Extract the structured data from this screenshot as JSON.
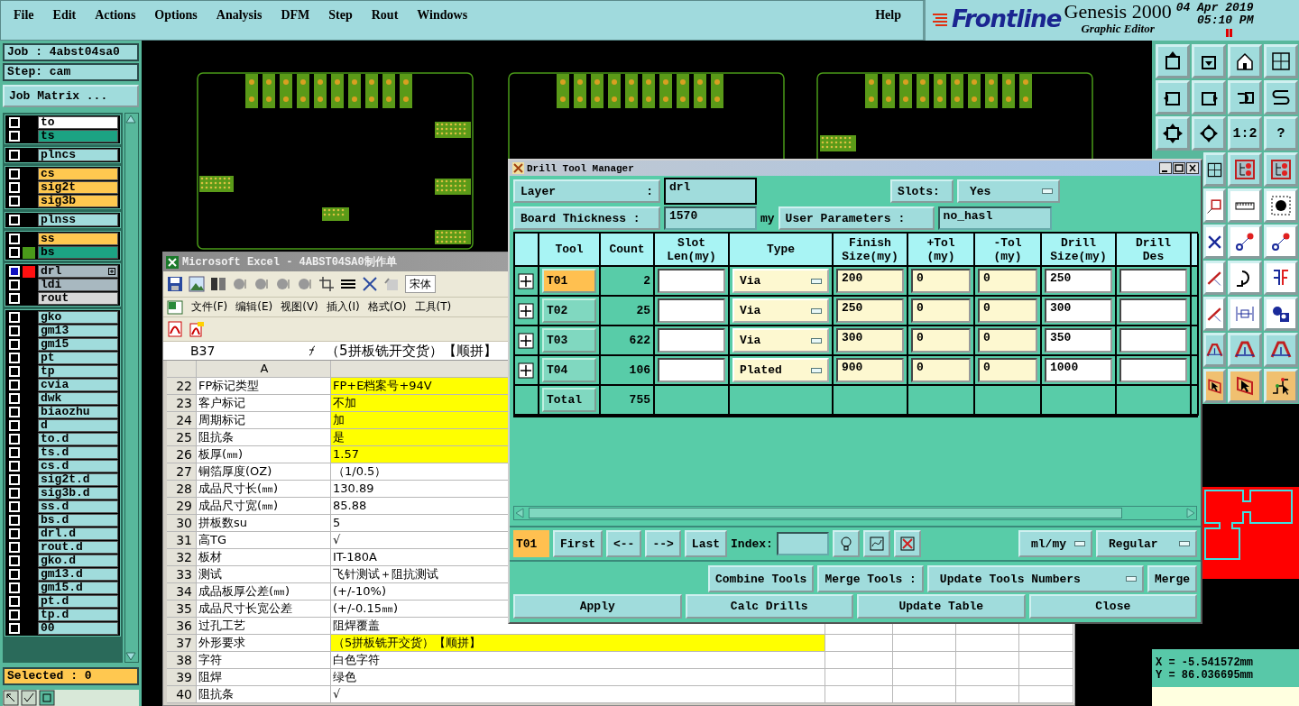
{
  "menu": {
    "items": [
      "File",
      "Edit",
      "Actions",
      "Options",
      "Analysis",
      "DFM",
      "Step",
      "Rout",
      "Windows"
    ],
    "help": "Help"
  },
  "logo": {
    "brand": "Frontline",
    "product": "Genesis 2000",
    "subtitle": "Graphic Editor",
    "date": "04 Apr 2019",
    "time": "05:10 PM"
  },
  "job_panel": {
    "job": "Job : 4abst04sa0",
    "step": "Step: cam",
    "matrix_button": "Job Matrix ..."
  },
  "layer_groups": [
    {
      "layers": [
        {
          "name": "to",
          "color": "#ffffff",
          "selected": false
        },
        {
          "name": "ts",
          "color": "#1ca383",
          "selected": false
        }
      ]
    },
    {
      "layers": [
        {
          "name": "plncs",
          "color": "#a0dcdc",
          "selected": false
        }
      ]
    },
    {
      "layers": [
        {
          "name": "cs",
          "color": "#ffc850",
          "selected": false
        },
        {
          "name": "sig2t",
          "color": "#ffc850",
          "selected": false
        },
        {
          "name": "sig3b",
          "color": "#ffc850",
          "selected": false
        }
      ]
    },
    {
      "layers": [
        {
          "name": "plnss",
          "color": "#a0dcdc",
          "selected": false
        }
      ]
    },
    {
      "layers": [
        {
          "name": "ss",
          "color": "#ffc850",
          "selected": false
        },
        {
          "name": "bs",
          "color": "#1ca383",
          "selected": false,
          "swatch": {
            "color": "#4a9a1a"
          }
        }
      ]
    },
    {
      "layers": [
        {
          "name": "drl",
          "color": "#a8b8c0",
          "selected": true,
          "swatch": {
            "color": "#ff1010"
          }
        },
        {
          "name": "ldi",
          "color": "#a8b8c0",
          "selected": false
        },
        {
          "name": "rout",
          "color": "#d8d8d8",
          "selected": false
        }
      ]
    },
    {
      "layers": [
        {
          "name": "gko",
          "color": "#a0dcdc",
          "selected": false
        },
        {
          "name": "gm13",
          "color": "#a0dcdc",
          "selected": false
        },
        {
          "name": "gm15",
          "color": "#a0dcdc",
          "selected": false
        },
        {
          "name": "pt",
          "color": "#a0dcdc",
          "selected": false
        },
        {
          "name": "tp",
          "color": "#a0dcdc",
          "selected": false
        },
        {
          "name": "cvia",
          "color": "#a0dcdc",
          "selected": false
        },
        {
          "name": "dwk",
          "color": "#a0dcdc",
          "selected": false
        },
        {
          "name": "biaozhu",
          "color": "#a0dcdc",
          "selected": false
        },
        {
          "name": "d",
          "color": "#a0dcdc",
          "selected": false
        },
        {
          "name": "to.d",
          "color": "#a0dcdc",
          "selected": false
        },
        {
          "name": "ts.d",
          "color": "#a0dcdc",
          "selected": false
        },
        {
          "name": "cs.d",
          "color": "#a0dcdc",
          "selected": false
        },
        {
          "name": "sig2t.d",
          "color": "#a0dcdc",
          "selected": false
        },
        {
          "name": "sig3b.d",
          "color": "#a0dcdc",
          "selected": false
        },
        {
          "name": "ss.d",
          "color": "#a0dcdc",
          "selected": false
        },
        {
          "name": "bs.d",
          "color": "#a0dcdc",
          "selected": false
        },
        {
          "name": "drl.d",
          "color": "#a0dcdc",
          "selected": false
        },
        {
          "name": "rout.d",
          "color": "#a0dcdc",
          "selected": false
        },
        {
          "name": "gko.d",
          "color": "#a0dcdc",
          "selected": false
        },
        {
          "name": "gm13.d",
          "color": "#a0dcdc",
          "selected": false
        },
        {
          "name": "gm15.d",
          "color": "#a0dcdc",
          "selected": false
        },
        {
          "name": "pt.d",
          "color": "#a0dcdc",
          "selected": false
        },
        {
          "name": "tp.d",
          "color": "#a0dcdc",
          "selected": false
        },
        {
          "name": "00",
          "color": "#a0dcdc",
          "selected": false
        }
      ]
    }
  ],
  "selected_count": "Selected : 0",
  "toolbar": {
    "ratio_label": "1:2",
    "help_label": "?"
  },
  "coordinates": {
    "x": "X = -5.541572mm",
    "y": "Y = 86.036695mm"
  },
  "excel": {
    "title": "Microsoft Excel - 4ABST04SA0制作单",
    "font": "宋体",
    "menu": [
      "文件(F)",
      "编辑(E)",
      "视图(V)",
      "插入(I)",
      "格式(O)",
      "工具(T)"
    ],
    "cell_ref": "B37",
    "formula": "（5拼板铣开交货）【顺拼】",
    "column_header": "A",
    "rows": [
      {
        "num": "22",
        "a": "FP标记类型",
        "b": "FP+E档案号+94V",
        "highlight": true
      },
      {
        "num": "23",
        "a": "客户标记",
        "b": "不加",
        "highlight": true
      },
      {
        "num": "24",
        "a": "周期标记",
        "b": "加",
        "highlight": true
      },
      {
        "num": "25",
        "a": "阻抗条",
        "b": "是",
        "highlight": true
      },
      {
        "num": "26",
        "a": "板厚(㎜)",
        "b": "1.57",
        "highlight": true
      },
      {
        "num": "27",
        "a": "铜箔厚度(OZ)",
        "b": "（1/0.5）",
        "highlight": false
      },
      {
        "num": "28",
        "a": "成品尺寸长(㎜)",
        "b": "130.89",
        "highlight": false
      },
      {
        "num": "29",
        "a": "成品尺寸宽(㎜)",
        "b": "85.88",
        "highlight": false
      },
      {
        "num": "30",
        "a": "拼板数su",
        "b": "5",
        "highlight": false
      },
      {
        "num": "31",
        "a": "高TG",
        "b": "√",
        "highlight": false
      },
      {
        "num": "32",
        "a": "板材",
        "b": "IT-180A",
        "highlight": false
      },
      {
        "num": "33",
        "a": "测试",
        "b": "飞针测试＋阻抗测试",
        "highlight": false
      },
      {
        "num": "34",
        "a": "成品板厚公差(㎜)",
        "b": "(+/-10%)",
        "highlight": false
      },
      {
        "num": "35",
        "a": "成品尺寸长宽公差",
        "b": "(+/-0.15㎜)",
        "highlight": false
      },
      {
        "num": "36",
        "a": "过孔工艺",
        "b": "阻焊覆盖",
        "highlight": false
      },
      {
        "num": "37",
        "a": "外形要求",
        "b": "（5拼板铣开交货）【顺拼】",
        "highlight": true
      },
      {
        "num": "38",
        "a": "字符",
        "b": "白色字符",
        "highlight": false
      },
      {
        "num": "39",
        "a": "阻焊",
        "b": "绿色",
        "highlight": false
      },
      {
        "num": "40",
        "a": "阻抗条",
        "b": "√",
        "highlight": false
      }
    ]
  },
  "drill_tools": {
    "title": "Drill Tool Manager",
    "layer_label": "Layer",
    "layer_colon": ":",
    "layer": "drl",
    "slots_label": "Slots:",
    "slots": "Yes",
    "thickness_label": "Board Thickness :",
    "thickness": "1570",
    "thickness_unit": "my",
    "user_params_label": "User Parameters :",
    "user_params": "no_hasl",
    "columns": [
      "Tool",
      "Count",
      "Slot\nLen(my)",
      "Type",
      "Finish\nSize(my)",
      "+Tol\n(my)",
      "-Tol\n(my)",
      "Drill\nSize(my)",
      "Drill\nDes"
    ],
    "rows": [
      {
        "tool": "T01",
        "count": "2",
        "type": "Via",
        "finish": "200",
        "plus_tol": "0",
        "minus_tol": "0",
        "drill": "250",
        "selected": true
      },
      {
        "tool": "T02",
        "count": "25",
        "type": "Via",
        "finish": "250",
        "plus_tol": "0",
        "minus_tol": "0",
        "drill": "300",
        "selected": false
      },
      {
        "tool": "T03",
        "count": "622",
        "type": "Via",
        "finish": "300",
        "plus_tol": "0",
        "minus_tol": "0",
        "drill": "350",
        "selected": false
      },
      {
        "tool": "T04",
        "count": "106",
        "type": "Plated",
        "finish": "900",
        "plus_tol": "0",
        "minus_tol": "0",
        "drill": "1000",
        "selected": false
      }
    ],
    "total_label": "Total",
    "total": "755",
    "current": "T01",
    "nav": [
      "First",
      "<--",
      "-->",
      "Last"
    ],
    "index_label": "Index:",
    "units": "ml/my",
    "mode": "Regular",
    "combine": "Combine Tools",
    "merge_label": "Merge Tools :",
    "merge_mode": "Update Tools Numbers",
    "merge": "Merge",
    "actions": [
      "Apply",
      "Calc Drills",
      "Update Table",
      "Close"
    ]
  }
}
